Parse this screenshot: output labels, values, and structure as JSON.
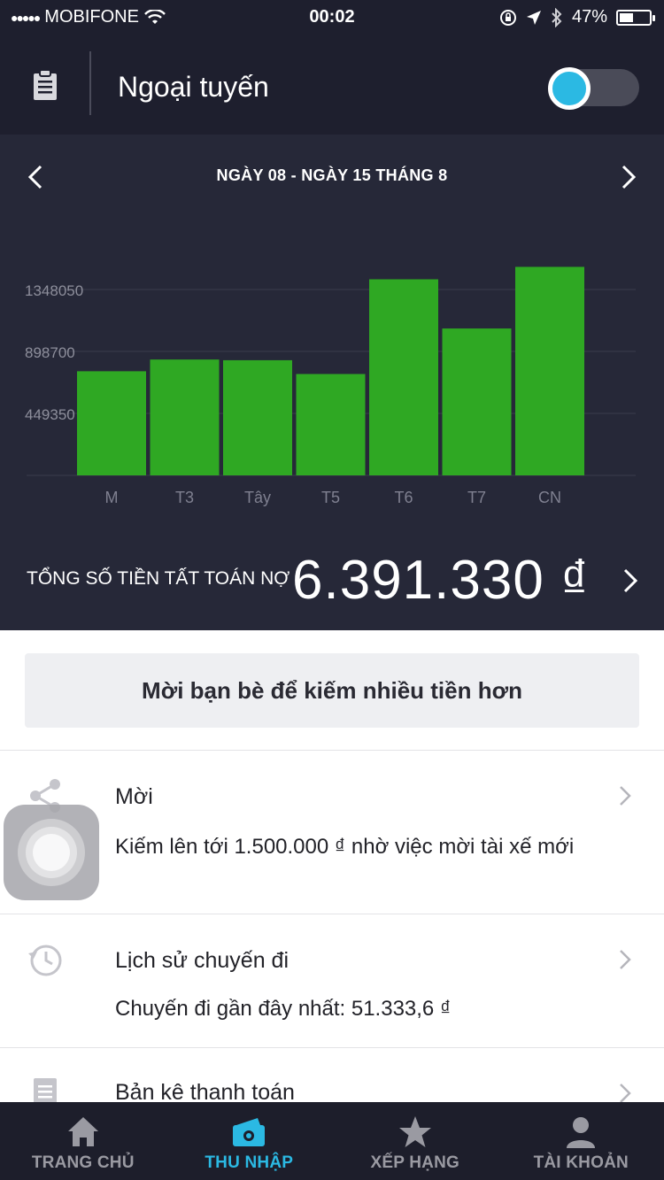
{
  "status_bar": {
    "signal": "●●●●●",
    "carrier": "MOBIFONE",
    "time": "00:02",
    "battery_percent": "47%",
    "battery_level": 0.47
  },
  "header": {
    "title": "Ngoại tuyến",
    "online_toggle_on": false,
    "toggle_color": "#2bb9e3"
  },
  "week_nav": {
    "label": "NGÀY 08 - NGÀY 15 THÁNG 8"
  },
  "chart_data": {
    "type": "bar",
    "categories": [
      "M",
      "T3",
      "Tây",
      "T5",
      "T6",
      "T7",
      "CN"
    ],
    "values": [
      755000,
      840000,
      835000,
      735000,
      1422000,
      1065000,
      1512000
    ],
    "y_ticks": [
      449350,
      898700,
      1348050
    ],
    "y_tick_labels": [
      "449350",
      "898700",
      "1348050"
    ],
    "ylim": [
      0,
      1348050
    ],
    "grid": true,
    "bar_color": "#2fa823"
  },
  "total": {
    "label": "TỔNG SỐ TIỀN TẤT TOÁN NỢ",
    "value": "6.391.330 ₫"
  },
  "invite_button": {
    "label": "Mời bạn bè để kiếm nhiều tiền hơn"
  },
  "rows": [
    {
      "title": "Mời",
      "subtitle": "Kiếm lên tới 1.500.000 ₫ nhờ việc mời tài xế mới",
      "icon": "share-icon"
    },
    {
      "title": "Lịch sử chuyến đi",
      "subtitle": "Chuyến đi gần đây nhất: 51.333,6 ₫",
      "icon": "history-icon"
    },
    {
      "title": "Bản kê thanh toán",
      "icon": "statement-icon"
    }
  ],
  "tabs": [
    {
      "label": "TRANG CHỦ",
      "icon": "home-icon",
      "active": false
    },
    {
      "label": "THU NHẬP",
      "icon": "earnings-icon",
      "active": true
    },
    {
      "label": "XẾP HẠNG",
      "icon": "star-icon",
      "active": false
    },
    {
      "label": "TÀI KHOẢN",
      "icon": "account-icon",
      "active": false
    }
  ],
  "colors": {
    "header_bg": "#1e1f2e",
    "panel_bg": "#262838",
    "accent": "#2bb9e3",
    "tab_bar_bg": "#1d1e2b"
  }
}
